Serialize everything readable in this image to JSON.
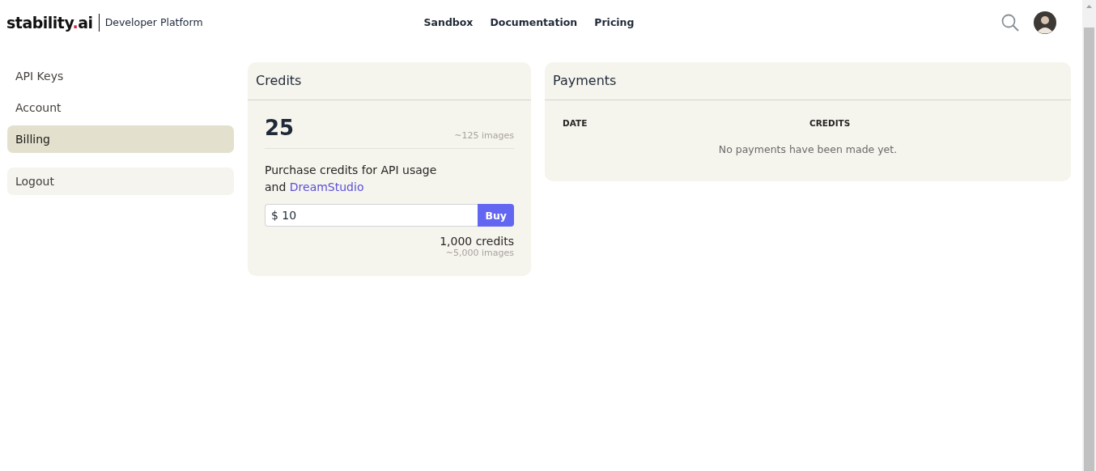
{
  "header": {
    "logo": [
      "stability",
      ".",
      "ai"
    ],
    "product": "Developer Platform",
    "nav": [
      "Sandbox",
      "Documentation",
      "Pricing"
    ]
  },
  "sidebar": {
    "items": [
      {
        "label": "API Keys",
        "selected": false
      },
      {
        "label": "Account",
        "selected": false
      },
      {
        "label": "Billing",
        "selected": true
      }
    ],
    "logout": "Logout"
  },
  "credits": {
    "title": "Credits",
    "balance": "25",
    "balance_images": "~125 images",
    "purchase_text": "Purchase credits for API usage and",
    "purchase_link": "DreamStudio",
    "amount": "$ 10",
    "buy": "Buy",
    "credits_amount": "1,000 credits",
    "credits_images": "~5,000 images"
  },
  "payments": {
    "title": "Payments",
    "columns": [
      "DATE",
      "CREDITS"
    ],
    "empty": "No payments have been made yet."
  }
}
